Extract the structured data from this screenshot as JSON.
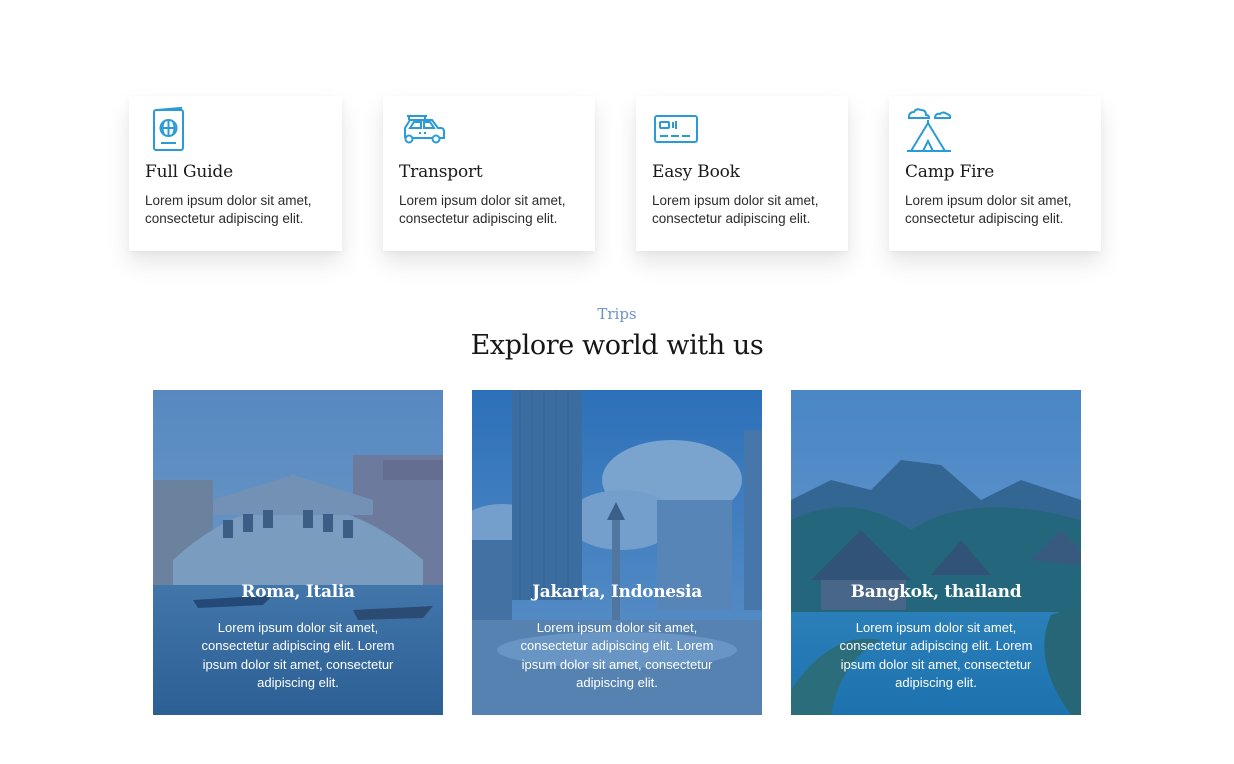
{
  "features": [
    {
      "icon": "passport-icon",
      "title": "Full Guide",
      "text": "Lorem ipsum dolor sit amet, consectetur adipiscing elit."
    },
    {
      "icon": "car-icon",
      "title": "Transport",
      "text": "Lorem ipsum dolor sit amet, consectetur adipiscing elit."
    },
    {
      "icon": "ticket-card-icon",
      "title": "Easy Book",
      "text": "Lorem ipsum dolor sit amet, consectetur adipiscing elit."
    },
    {
      "icon": "tent-icon",
      "title": "Camp Fire",
      "text": "Lorem ipsum dolor sit amet, consectetur adipiscing elit."
    }
  ],
  "section": {
    "eyebrow": "Trips",
    "title": "Explore world with us"
  },
  "trips": [
    {
      "title": "Roma, Italia",
      "text": "Lorem ipsum dolor sit amet, consectetur adipiscing elit. Lorem ipsum dolor sit amet, consectetur adipiscing elit."
    },
    {
      "title": "Jakarta, Indonesia",
      "text": "Lorem ipsum dolor sit amet, consectetur adipiscing elit. Lorem ipsum dolor sit amet, consectetur adipiscing elit."
    },
    {
      "title": "Bangkok, thailand",
      "text": "Lorem ipsum dolor sit amet, consectetur adipiscing elit. Lorem ipsum dolor sit amet, consectetur adipiscing elit."
    }
  ],
  "colors": {
    "icon_accent": "#2a9bd6",
    "eyebrow": "#6b93c9",
    "overlay": "#1f62ad"
  }
}
